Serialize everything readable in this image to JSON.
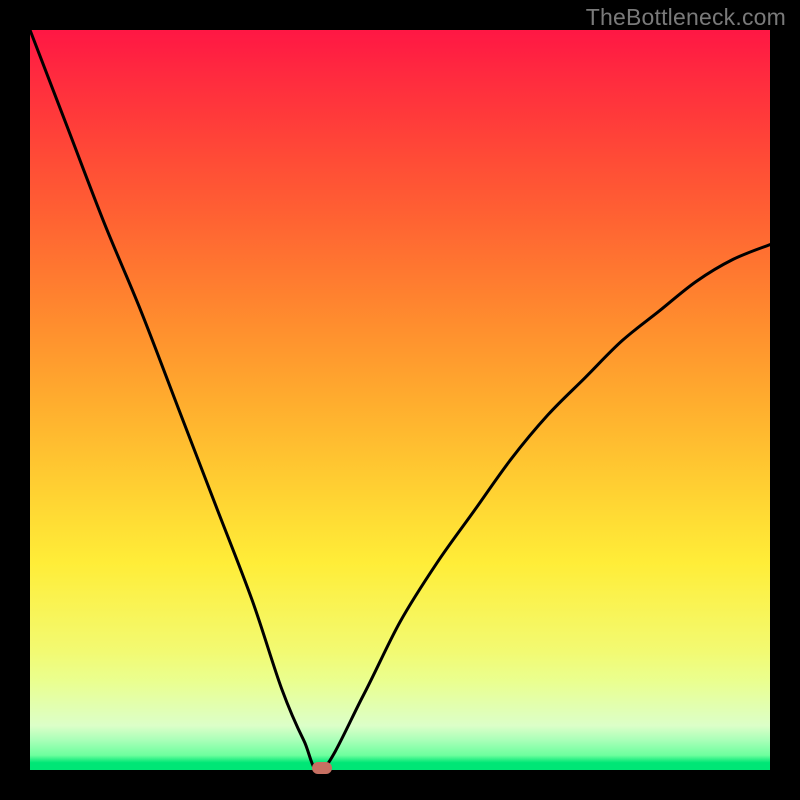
{
  "watermark": "TheBottleneck.com",
  "chart_data": {
    "type": "line",
    "title": "",
    "xlabel": "",
    "ylabel": "",
    "xlim": [
      0,
      100
    ],
    "ylim": [
      0,
      100
    ],
    "background_gradient": {
      "top": "#ff1744",
      "mid": "#ffeb3b",
      "bottom": "#00E676"
    },
    "series": [
      {
        "name": "bottleneck-curve",
        "x": [
          0,
          5,
          10,
          15,
          20,
          25,
          30,
          34,
          37,
          39.5,
          45,
          50,
          55,
          60,
          65,
          70,
          75,
          80,
          85,
          90,
          95,
          100
        ],
        "y": [
          100,
          87,
          74,
          62,
          49,
          36,
          23,
          11,
          4,
          0,
          10,
          20,
          28,
          35,
          42,
          48,
          53,
          58,
          62,
          66,
          69,
          71
        ]
      }
    ],
    "marker": {
      "name": "optimal-point",
      "x": 39.5,
      "y": 0,
      "color": "#c77062"
    }
  }
}
